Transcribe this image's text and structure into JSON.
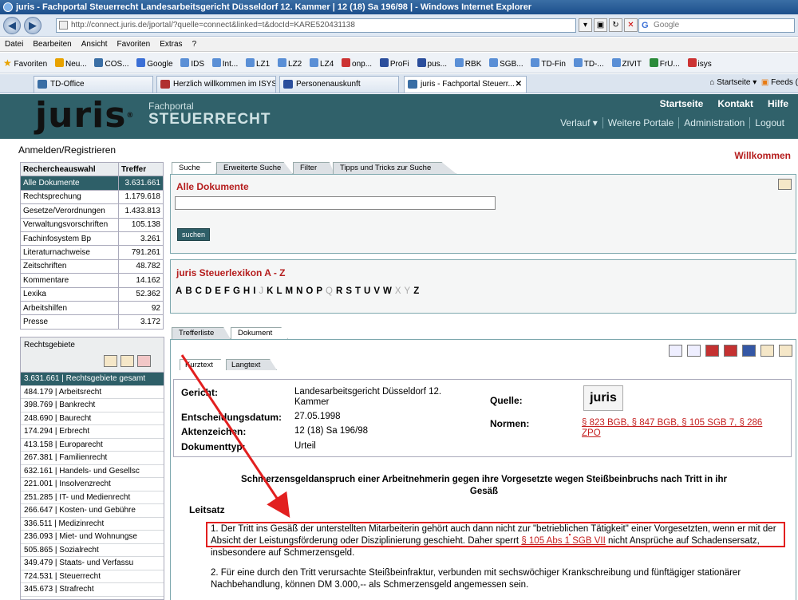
{
  "window": {
    "title": "juris - Fachportal Steuerrecht Landesarbeitsgericht Düsseldorf 12. Kammer | 12 (18) Sa 196/98 | - Windows Internet Explorer"
  },
  "address": {
    "url": "http://connect.juris.de/jportal/?quelle=connect&linked=t&docId=KARE520431138",
    "search_placeholder": "Google"
  },
  "menu": [
    "Datei",
    "Bearbeiten",
    "Ansicht",
    "Favoriten",
    "Extras",
    "?"
  ],
  "favorites": {
    "label": "Favoriten",
    "items": [
      "Neu...",
      "COS...",
      "Google",
      "IDS",
      "Int...",
      "LZ1",
      "LZ2",
      "LZ4",
      "onp...",
      "ProFi",
      "pus...",
      "RBK",
      "SGB...",
      "TD-Fin",
      "TD-...",
      "ZIVIT",
      "FrU...",
      "isys"
    ]
  },
  "browser_tabs": [
    "TD-Office",
    "Herzlich willkommen im ISYS-...",
    "Personenauskunft",
    "juris - Fachportal Steuerr..."
  ],
  "browser_tools": {
    "home": "Startseite",
    "feeds": "Feeds ("
  },
  "header": {
    "logo": "juris",
    "portal_line1": "Fachportal",
    "portal_line2": "STEUERRECHT",
    "topnav": [
      "Startseite",
      "Kontakt",
      "Hilfe"
    ],
    "subnav": [
      "Verlauf ▾",
      "Weitere Portale",
      "Administration",
      "Logout"
    ]
  },
  "login": "Anmelden/Registrieren",
  "welcome": "Willkommen",
  "recherche": {
    "col1": "Rechercheauswahl",
    "col2": "Treffer",
    "rows": [
      {
        "label": "Alle Dokumente",
        "count": "3.631.661"
      },
      {
        "label": "Rechtsprechung",
        "count": "1.179.618"
      },
      {
        "label": "Gesetze/Verordnungen",
        "count": "1.433.813"
      },
      {
        "label": "Verwaltungsvorschriften",
        "count": "105.138"
      },
      {
        "label": "Fachinfosystem Bp",
        "count": "3.261"
      },
      {
        "label": "Literaturnachweise",
        "count": "791.261"
      },
      {
        "label": "Zeitschriften",
        "count": "48.782"
      },
      {
        "label": "Kommentare",
        "count": "14.162"
      },
      {
        "label": "Lexika",
        "count": "52.362"
      },
      {
        "label": "Arbeitshilfen",
        "count": "92"
      },
      {
        "label": "Presse",
        "count": "3.172"
      }
    ]
  },
  "rechtsgebiete": {
    "title": "Rechtsgebiete",
    "items": [
      "3.631.661 | Rechtsgebiete gesamt",
      "484.179 | Arbeitsrecht",
      "398.769 | Bankrecht",
      "248.690 | Baurecht",
      "174.294 | Erbrecht",
      "413.158 | Europarecht",
      "267.381 | Familienrecht",
      "632.161 | Handels- und Gesellsc",
      "221.001 | Insolvenzrecht",
      "251.285 | IT- und Medienrecht",
      "266.647 | Kosten- und Gebühre",
      "336.511 | Medizinrecht",
      "236.093 | Miet- und Wohnungse",
      "505.865 | Sozialrecht",
      "349.479 | Staats- und Verfassu",
      "724.531 | Steuerrecht",
      "345.673 | Strafrecht"
    ]
  },
  "search_tabs": [
    "Suche",
    "Erweiterte Suche",
    "Filter",
    "Tipps und Tricks zur Suche"
  ],
  "search": {
    "heading": "Alle Dokumente",
    "button": "suchen"
  },
  "lexikon": {
    "heading": "juris Steuerlexikon A - Z",
    "letters": [
      "A",
      "B",
      "C",
      "D",
      "E",
      "F",
      "G",
      "H",
      "I",
      "J",
      "K",
      "L",
      "M",
      "N",
      "O",
      "P",
      "Q",
      "R",
      "S",
      "T",
      "U",
      "V",
      "W",
      "X",
      "Y",
      "Z"
    ],
    "disabled": [
      "J",
      "Q",
      "X",
      "Y"
    ]
  },
  "doc_tabs": [
    "Trefferliste",
    "Dokument"
  ],
  "sub_tabs": [
    "Kurztext",
    "Langtext"
  ],
  "document": {
    "gericht_label": "Gericht:",
    "gericht": "Landesarbeitsgericht Düsseldorf 12. Kammer",
    "datum_label": "Entscheidungsdatum:",
    "datum": "27.05.1998",
    "az_label": "Aktenzeichen:",
    "az": "12 (18) Sa 196/98",
    "typ_label": "Dokumenttyp:",
    "typ": "Urteil",
    "quelle_label": "Quelle:",
    "quelle_logo": "juris",
    "normen_label": "Normen:",
    "normen": "§ 823 BGB, § 847 BGB, § 105 SGB 7, § 286 ZPO",
    "title": "Schmerzensgeldanspruch einer Arbeitnehmerin gegen ihre Vorgesetzte wegen Steißbeinbruchs nach Tritt in ihr Gesäß",
    "leitsatz_label": "Leitsatz",
    "p1_a": "1. Der Tritt ins Gesäß der unterstellten Mitarbeiterin gehört auch dann nicht zur \"betrieblichen Tätigkeit\" einer Vorgesetzten, wenn er mit der Absicht der Leistungsförderung oder Disziplinierung geschieht.",
    "p1_b": " Daher sperrt ",
    "p1_link": "§ 105 Abs 1 SGB VII",
    "p1_c": " nicht Ansprüche auf Schadensersatz, insbesondere auf Schmerzensgeld.",
    "p2": "2. Für eine durch den Tritt verursachte Steißbeinfraktur, verbunden mit sechswöchiger Krankschreibung und fünftägiger stationärer Nachbehandlung, können DM 3.000,-- als Schmerzensgeld angemessen sein."
  },
  "colors": {
    "accent": "#30616a",
    "red": "#b51d1d",
    "annotation": "#e21f1f"
  }
}
